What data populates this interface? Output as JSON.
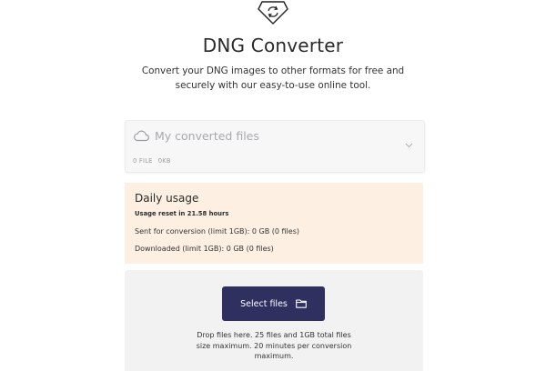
{
  "header": {
    "logo_icon": "convert-tag-icon",
    "title": "DNG Converter",
    "subtitle": "Convert your DNG images to other formats for free and securely with our easy-to-use online tool."
  },
  "converted_files": {
    "title": "My converted files",
    "file_count": "0 FILE",
    "size": "0KB",
    "icon": "cloud-icon",
    "expand_icon": "chevron-down-icon"
  },
  "daily_usage": {
    "title": "Daily usage",
    "reset": "Usage reset in 21.58 hours",
    "sent": "Sent for conversion (limit 1GB): 0 GB (0 files)",
    "downloaded": "Downloaded (limit 1GB): 0 GB (0 files)",
    "background": "#fdf0e3"
  },
  "upload": {
    "button_label": "Select files",
    "button_icon": "folder-icon",
    "button_color": "#2f3060",
    "drop_text": "Drop files here. 25 files and 1GB total files size maximum. 20 minutes per conversion maximum."
  }
}
